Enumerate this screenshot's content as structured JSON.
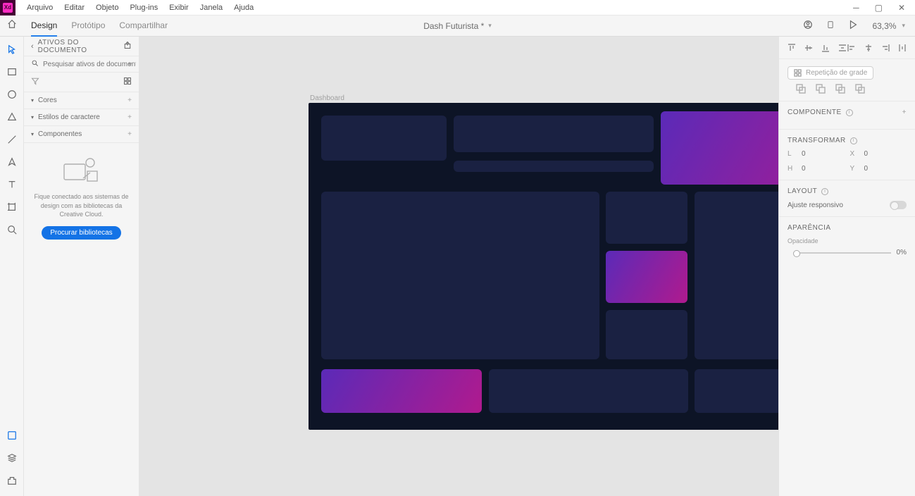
{
  "menubar": {
    "logo_text": "Xd",
    "items": [
      "Arquivo",
      "Editar",
      "Objeto",
      "Plug-ins",
      "Exibir",
      "Janela",
      "Ajuda"
    ]
  },
  "modebar": {
    "modes": [
      "Design",
      "Protótipo",
      "Compartilhar"
    ],
    "active_mode": 0,
    "doc_title": "Dash Futurista *",
    "zoom": "63,3%"
  },
  "left_panel": {
    "title": "ATIVOS DO DOCUMENTO",
    "search_placeholder": "Pesquisar ativos de documento",
    "sections": {
      "cores": "Cores",
      "estilos": "Estilos de caractere",
      "componentes": "Componentes"
    },
    "empty_msg": "Fique conectado aos sistemas de design com as bibliotecas da Creative Cloud.",
    "browse_btn": "Procurar bibliotecas"
  },
  "canvas": {
    "artboard_label": "Dashboard"
  },
  "right_panel": {
    "repeat_label": "Repetição de grade",
    "componente": "COMPONENTE",
    "transformar": "TRANSFORMAR",
    "transform": {
      "l_label": "L",
      "l_val": "0",
      "x_label": "X",
      "x_val": "0",
      "h_label": "H",
      "h_val": "0",
      "y_label": "Y",
      "y_val": "0"
    },
    "layout": "LAYOUT",
    "responsive": "Ajuste responsivo",
    "aparencia": "APARÊNCIA",
    "opacidade_label": "Opacidade",
    "opacidade_val": "0%"
  }
}
